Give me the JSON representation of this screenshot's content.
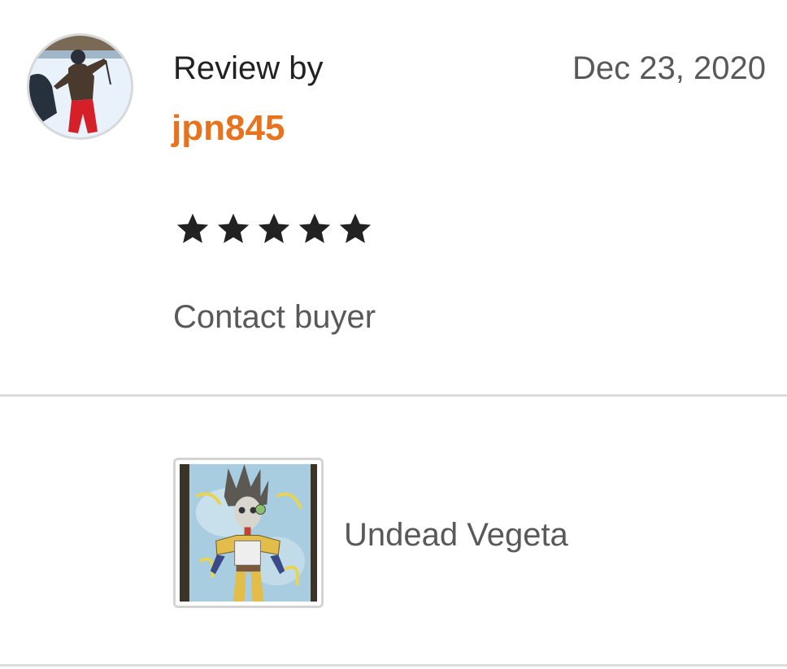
{
  "review": {
    "label": "Review by",
    "username": "jpn845",
    "date": "Dec 23, 2020",
    "rating": 5,
    "max_rating": 5,
    "contact_label": "Contact buyer"
  },
  "product": {
    "title": "Undead Vegeta"
  },
  "colors": {
    "username": "#e8731f",
    "star": "#222222",
    "divider": "#dcdcdc",
    "secondary_text": "#595959"
  },
  "icons": {
    "star": "star-filled-icon"
  }
}
